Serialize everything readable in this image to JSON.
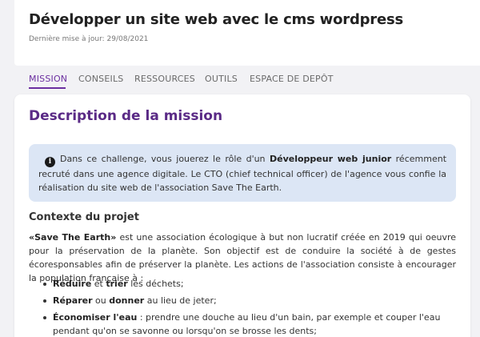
{
  "header": {
    "title": "Développer un site web avec le cms wordpress",
    "updated": "Dernière mise à jour: 29/08/2021"
  },
  "tabs": [
    {
      "label": "MISSION",
      "active": true
    },
    {
      "label": "CONSEILS",
      "active": false
    },
    {
      "label": "RESSOURCES",
      "active": false
    },
    {
      "label": "OUTILS",
      "active": false
    },
    {
      "label": "ESPACE DE DEPÔT",
      "active": false
    }
  ],
  "main": {
    "heading": "Description de la mission",
    "info": {
      "icon": "info-icon",
      "icon_glyph": "i",
      "text_before": "Dans ce challenge, vous jouerez le rôle d'un ",
      "text_bold": "Développeur web junior",
      "text_after": " récemment recruté dans une agence digitale. Le CTO (chief technical officer) de l'agence vous confie la réalisation du site web de l'association Save The Earth."
    },
    "context_heading": "Contexte du projet",
    "context": {
      "bold": "«Save The Earth»",
      "text": " est une association écologique à but non lucratif créée en 2019 qui oeuvre pour la préservation de la planète. Son objectif est de conduire la société à de gestes écoresponsables afin de préserver la planète. Les actions de l'association consiste à encourager la population française à :"
    },
    "actions": [
      {
        "b1": "Réduire",
        "mid": " et ",
        "b2": "trier",
        "rest": " les déchets;"
      },
      {
        "b1": "Réparer",
        "mid": " ou ",
        "b2": "donner",
        "rest": " au lieu de jeter;"
      },
      {
        "b1": "Économiser l'eau",
        "mid": "",
        "b2": "",
        "rest": " : prendre une douche au lieu d'un bain, par exemple et couper l'eau pendant qu'on se savonne ou lorsqu'on se brosse les dents;"
      }
    ]
  },
  "colors": {
    "accent": "#6b2fa0",
    "heading": "#5a2a86",
    "info_bg": "#dce6f5",
    "page_bg": "#f2f2f5"
  }
}
